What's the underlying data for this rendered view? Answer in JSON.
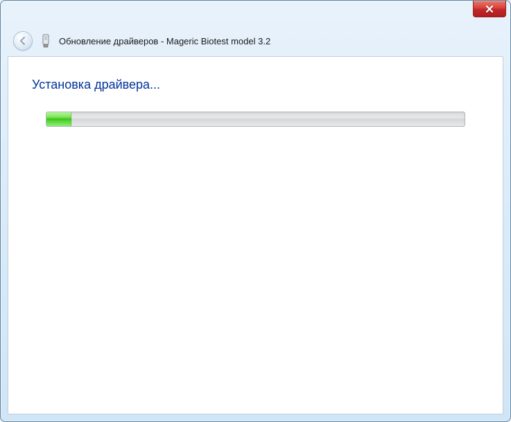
{
  "window": {
    "title": "Обновление драйверов - Mageric Biotest model 3.2"
  },
  "content": {
    "heading": "Установка драйвера...",
    "progress_percent": 6
  }
}
